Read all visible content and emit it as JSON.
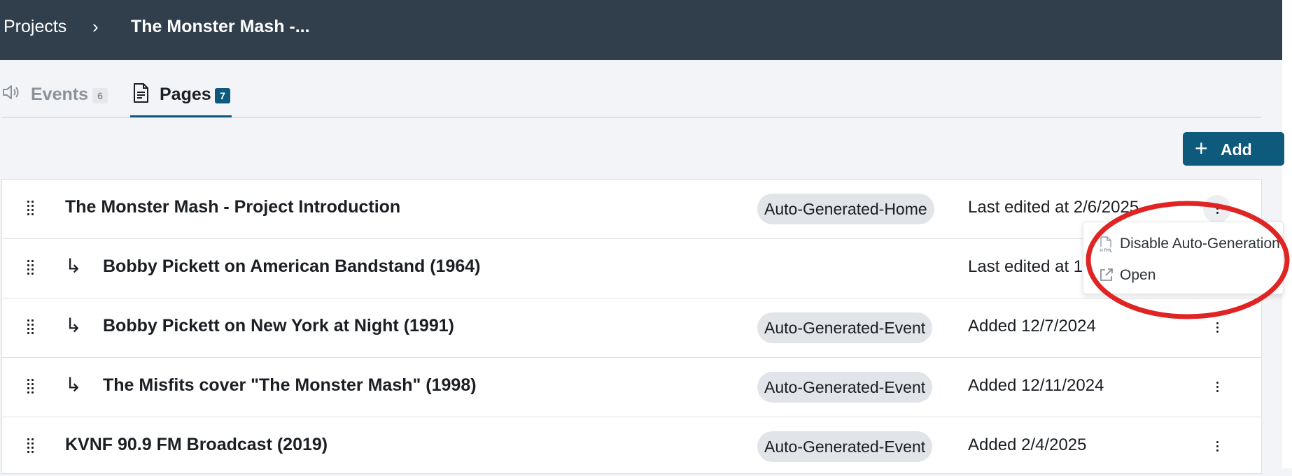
{
  "breadcrumb": {
    "projects_label": "Projects",
    "separator": "›",
    "current_label": "The Monster Mash -..."
  },
  "tabs": [
    {
      "label": "Events",
      "count": "6",
      "icon": "speaker-icon",
      "active": false
    },
    {
      "label": "Pages",
      "count": "7",
      "icon": "document-icon",
      "active": true
    }
  ],
  "toolbar": {
    "add_label": "Add",
    "add_icon": "plus-icon"
  },
  "pages": [
    {
      "title": "The Monster Mash - Project Introduction",
      "child": false,
      "tag": "Auto-Generated-Home",
      "status": "Last edited at 2/6/2025"
    },
    {
      "title": "Bobby Pickett on American Bandstand (1964)",
      "child": true,
      "tag": "",
      "status": "Last edited at 1"
    },
    {
      "title": "Bobby Pickett on New York at Night (1991)",
      "child": true,
      "tag": "Auto-Generated-Event",
      "status": "Added 12/7/2024"
    },
    {
      "title": "The Misfits cover \"The Monster Mash\" (1998)",
      "child": true,
      "tag": "Auto-Generated-Event",
      "status": "Added 12/11/2024"
    },
    {
      "title": "KVNF 90.9 FM Broadcast (2019)",
      "child": false,
      "tag": "Auto-Generated-Event",
      "status": "Added 2/4/2025"
    }
  ],
  "row_menu": {
    "items": [
      {
        "label": "Disable Auto-Generation",
        "icon": "html-file-icon"
      },
      {
        "label": "Open",
        "icon": "external-link-icon"
      }
    ]
  },
  "child_arrow": "↳",
  "colors": {
    "topbar": "#313e4b",
    "accent": "#0e5a7c",
    "tag_bg": "#e1e4e8",
    "highlight": "#e02424",
    "background": "#f2f4f7"
  }
}
